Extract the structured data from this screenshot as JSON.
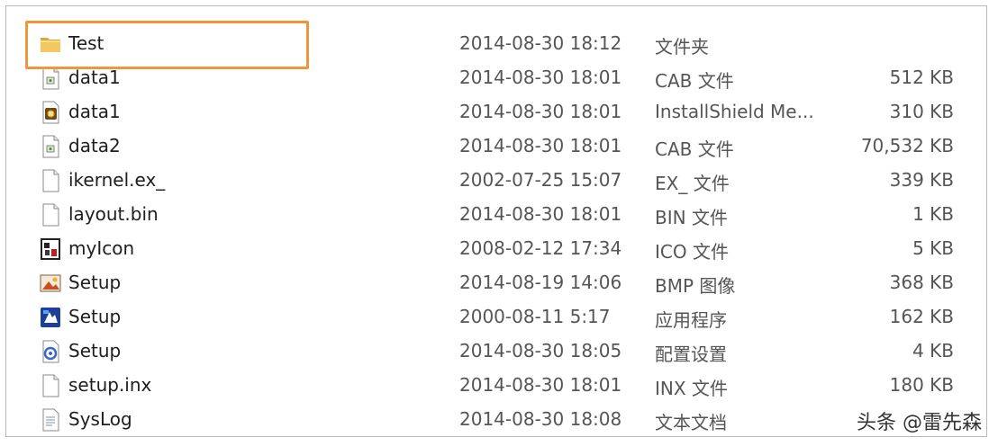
{
  "files": [
    {
      "name": "Test",
      "date": "2014-08-30 18:12",
      "type": "文件夹",
      "size": "",
      "icon": "folder-icon"
    },
    {
      "name": "data1",
      "date": "2014-08-30 18:01",
      "type": "CAB 文件",
      "size": "512 KB",
      "icon": "cab-file-icon"
    },
    {
      "name": "data1",
      "date": "2014-08-30 18:01",
      "type": "InstallShield Me...",
      "size": "310 KB",
      "icon": "installshield-file-icon"
    },
    {
      "name": "data2",
      "date": "2014-08-30 18:01",
      "type": "CAB 文件",
      "size": "70,532 KB",
      "icon": "cab-file-icon"
    },
    {
      "name": "ikernel.ex_",
      "date": "2002-07-25 15:07",
      "type": "EX_ 文件",
      "size": "339 KB",
      "icon": "blank-file-icon"
    },
    {
      "name": "layout.bin",
      "date": "2014-08-30 18:01",
      "type": "BIN 文件",
      "size": "1 KB",
      "icon": "blank-file-icon"
    },
    {
      "name": "myIcon",
      "date": "2008-02-12 17:34",
      "type": "ICO 文件",
      "size": "5 KB",
      "icon": "ico-file-icon"
    },
    {
      "name": "Setup",
      "date": "2014-08-19 14:06",
      "type": "BMP 图像",
      "size": "368 KB",
      "icon": "bmp-image-icon"
    },
    {
      "name": "Setup",
      "date": "2000-08-11 5:17",
      "type": "应用程序",
      "size": "162 KB",
      "icon": "setup-app-icon"
    },
    {
      "name": "Setup",
      "date": "2014-08-30 18:05",
      "type": "配置设置",
      "size": "4 KB",
      "icon": "config-settings-icon"
    },
    {
      "name": "setup.inx",
      "date": "2014-08-30 18:01",
      "type": "INX 文件",
      "size": "180 KB",
      "icon": "blank-file-icon"
    },
    {
      "name": "SysLog",
      "date": "2014-08-30 18:08",
      "type": "文本文档",
      "size": "",
      "icon": "text-document-icon"
    }
  ],
  "watermark": "头条 @雷先森",
  "colors": {
    "highlight": "#f0953a",
    "folder": "#e8b84a",
    "text": "#1e1e1e",
    "meta_text": "#555555"
  }
}
